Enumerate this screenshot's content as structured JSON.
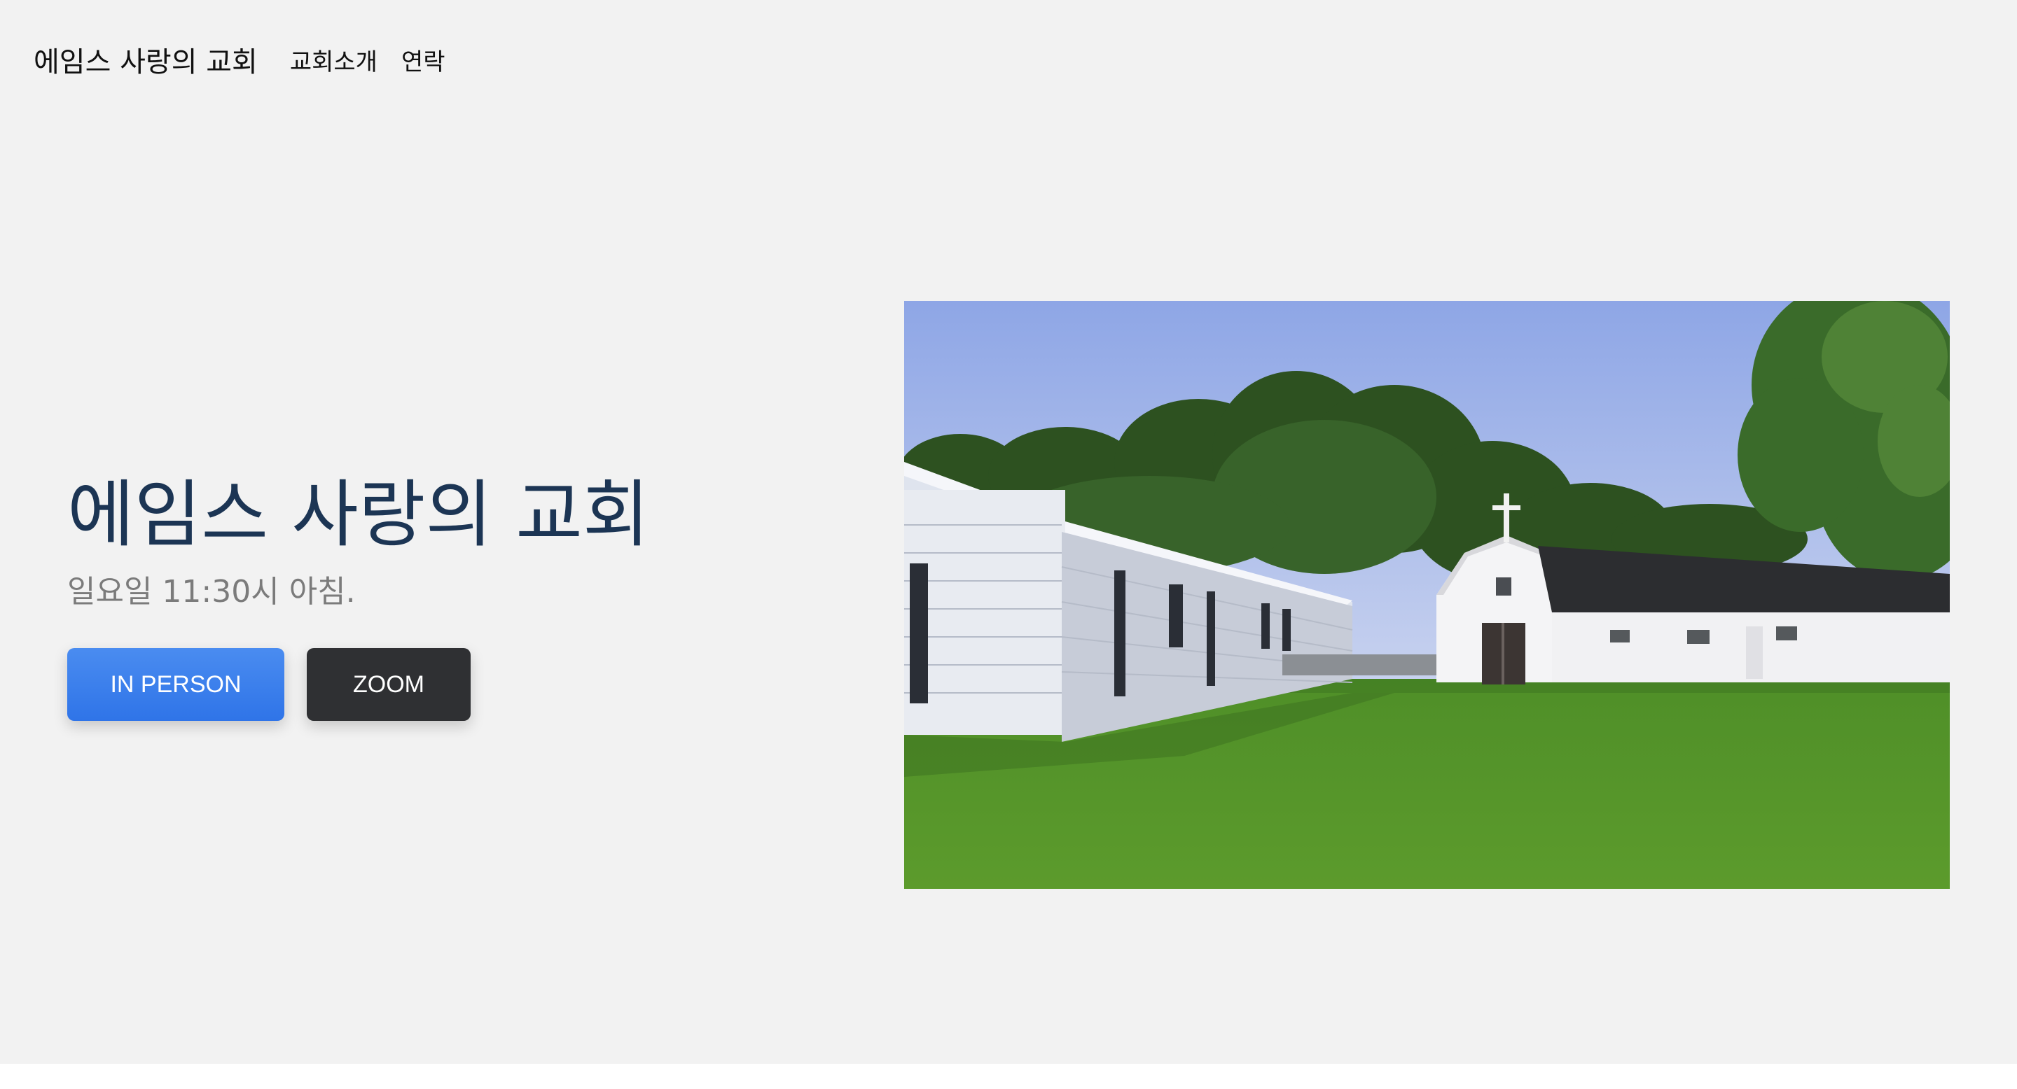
{
  "nav": {
    "brand": "에임스 사랑의 교회",
    "links": [
      "교회소개",
      "연락"
    ]
  },
  "hero": {
    "title": "에임스 사랑의 교회",
    "subtitle": "일요일 11:30시 아침.",
    "buttons": {
      "in_person": "IN PERSON",
      "zoom": "ZOOM"
    }
  },
  "colors": {
    "background": "#f2f2f2",
    "title": "#1c3554",
    "primary_button": "#3a7fee",
    "dark_button": "#2f3033"
  }
}
